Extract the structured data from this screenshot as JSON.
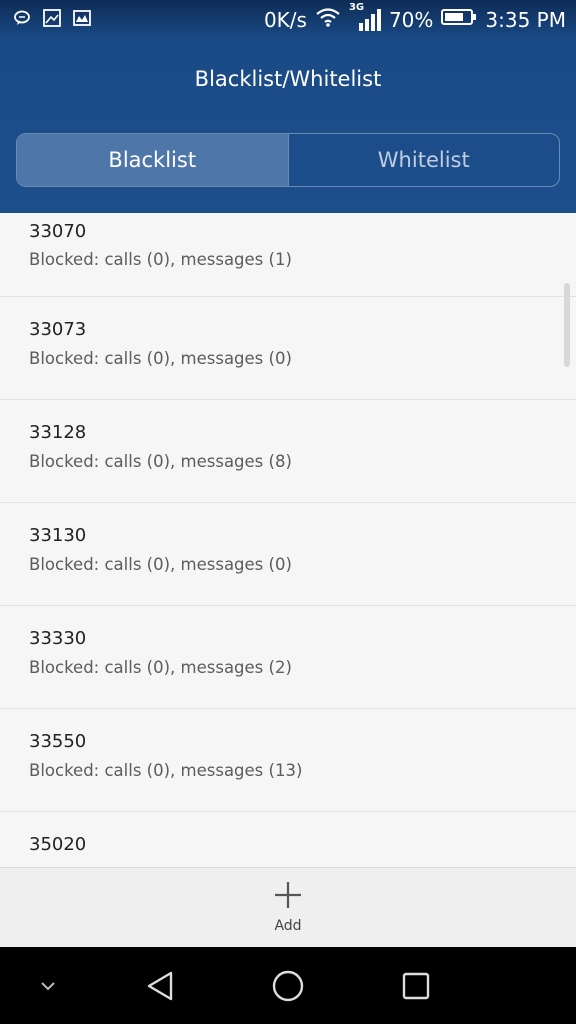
{
  "status_bar": {
    "icons_left": [
      "chat-bubble-icon",
      "image-icon",
      "gallery-icon"
    ],
    "net_speed": "0K/s",
    "network_type": "3G",
    "battery_percent": "70%",
    "time": "3:35 PM"
  },
  "header": {
    "title": "Blacklist/Whitelist",
    "tabs": [
      {
        "label": "Blacklist",
        "active": true
      },
      {
        "label": "Whitelist",
        "active": false
      }
    ]
  },
  "list": {
    "items": [
      {
        "number": "33070",
        "detail": "Blocked: calls (0), messages (1)"
      },
      {
        "number": "33073",
        "detail": "Blocked: calls (0), messages (0)"
      },
      {
        "number": "33128",
        "detail": "Blocked: calls (0), messages (8)"
      },
      {
        "number": "33130",
        "detail": "Blocked: calls (0), messages (0)"
      },
      {
        "number": "33330",
        "detail": "Blocked: calls (0), messages (2)"
      },
      {
        "number": "33550",
        "detail": "Blocked: calls (0), messages (13)"
      },
      {
        "number": "35020",
        "detail": ""
      }
    ]
  },
  "actions": {
    "add_label": "Add"
  },
  "navbar": {
    "buttons": [
      "chevron-down-icon",
      "back-icon",
      "home-icon",
      "recents-icon"
    ]
  },
  "colors": {
    "header_bg": "#1d4f8d",
    "active_tab_bg": "#4f76a8",
    "list_bg": "#f6f6f6"
  }
}
